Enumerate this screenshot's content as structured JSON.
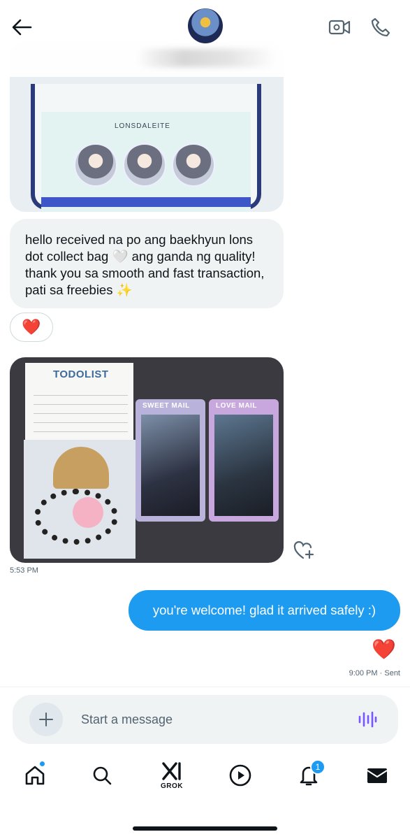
{
  "header": {
    "back_label": "Back",
    "contact_name": "",
    "icons": {
      "back": "arrow-left-icon",
      "video": "video-camera-icon",
      "phone": "phone-icon"
    }
  },
  "messages": [
    {
      "direction": "incoming",
      "type": "image",
      "description_icon": "image"
    },
    {
      "direction": "incoming",
      "type": "text",
      "text": "hello received na po ang baekhyun lons dot collect bag 🤍 ang ganda ng quality! thank you sa smooth and fast transaction, pati sa freebies ✨",
      "reaction": "❤️"
    },
    {
      "direction": "incoming",
      "type": "image",
      "photo_texts": {
        "note_title": "TODOLIST",
        "card1": "SWEET MAIL",
        "card2": "LOVE MAIL"
      },
      "time": "5:53 PM"
    },
    {
      "direction": "outgoing",
      "type": "text",
      "text": "you're welcome! glad it arrived safely :)",
      "reaction": "❤️",
      "time": "9:00 PM",
      "status": "Sent"
    }
  ],
  "photo1_texts": {
    "bag_title": "LONSDALEITE"
  },
  "composer": {
    "placeholder": "Start a message",
    "icons": {
      "plus": "plus-icon",
      "voice": "voice-wave-icon"
    }
  },
  "nav": {
    "items": [
      {
        "name": "home",
        "icon": "home-icon",
        "has_dot": true
      },
      {
        "name": "search",
        "icon": "search-icon"
      },
      {
        "name": "grok",
        "icon": "grok-icon",
        "label": "GROK"
      },
      {
        "name": "video",
        "icon": "play-icon"
      },
      {
        "name": "notifications",
        "icon": "bell-icon",
        "badge": "1"
      },
      {
        "name": "messages",
        "icon": "envelope-icon"
      }
    ]
  },
  "colors": {
    "accent": "#1d9bf0",
    "bubble_in": "#eff3f4",
    "text": "#0f1419",
    "muted": "#536471",
    "heart": "#e0182d"
  }
}
